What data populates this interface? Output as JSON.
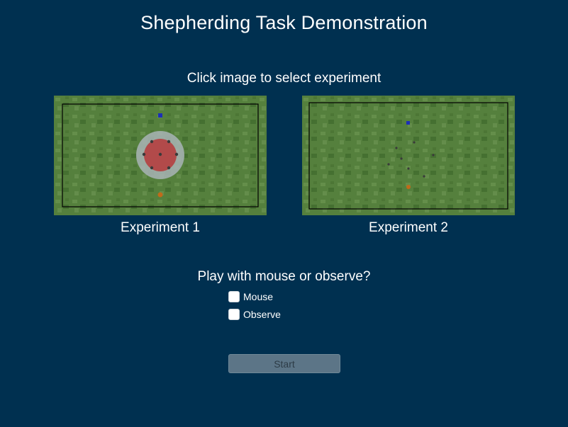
{
  "page": {
    "title": "Shepherding Task Demonstration",
    "subtitle": "Click image to select experiment"
  },
  "experiments": [
    {
      "caption": "Experiment 1"
    },
    {
      "caption": "Experiment 2"
    }
  ],
  "mode": {
    "question": "Play with mouse or observe?",
    "options": [
      {
        "label": "Mouse",
        "checked": false
      },
      {
        "label": "Observe",
        "checked": false
      }
    ]
  },
  "start": {
    "label": "Start",
    "enabled": false
  },
  "colors": {
    "background": "#003050",
    "grass_light": "#5f8a45",
    "grass_dark": "#3f6a2c",
    "target_ring": "#a9b4b6",
    "target_fill": "#b24a4a",
    "herder_agent": "#1c2fb8",
    "sheep_agent": "#c06a1a",
    "boundary": "#000000"
  }
}
